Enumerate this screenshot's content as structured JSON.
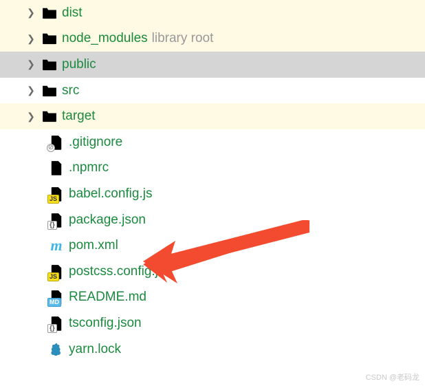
{
  "tree": {
    "folders": [
      {
        "name": "dist",
        "color": "orange",
        "highlighted": true,
        "selected": false,
        "hint": ""
      },
      {
        "name": "node_modules",
        "color": "orange",
        "highlighted": true,
        "selected": false,
        "hint": "library root"
      },
      {
        "name": "public",
        "color": "gray",
        "highlighted": false,
        "selected": true,
        "hint": ""
      },
      {
        "name": "src",
        "color": "gray",
        "highlighted": false,
        "selected": false,
        "hint": ""
      },
      {
        "name": "target",
        "color": "orange",
        "highlighted": true,
        "selected": false,
        "hint": ""
      }
    ],
    "files": [
      {
        "name": ".gitignore",
        "icon": "ignore"
      },
      {
        "name": ".npmrc",
        "icon": "file"
      },
      {
        "name": "babel.config.js",
        "icon": "js"
      },
      {
        "name": "package.json",
        "icon": "json"
      },
      {
        "name": "pom.xml",
        "icon": "m"
      },
      {
        "name": "postcss.config.js",
        "icon": "js"
      },
      {
        "name": "README.md",
        "icon": "md"
      },
      {
        "name": "tsconfig.json",
        "icon": "json"
      },
      {
        "name": "yarn.lock",
        "icon": "yarn"
      }
    ]
  },
  "watermark": "CSDN @老码龙"
}
